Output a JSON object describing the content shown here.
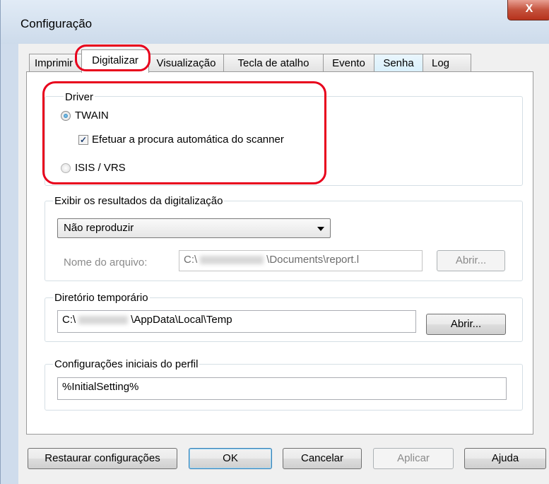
{
  "window": {
    "title": "Configuração",
    "close_label": "X"
  },
  "tabs": [
    {
      "label": "Imprimir"
    },
    {
      "label": "Digitalizar"
    },
    {
      "label": "Visualização"
    },
    {
      "label": "Tecla de atalho"
    },
    {
      "label": "Evento"
    },
    {
      "label": "Senha"
    },
    {
      "label": "Log"
    }
  ],
  "driver": {
    "group_label": "Driver",
    "twain_label": "TWAIN",
    "twain_selected": true,
    "auto_search_label": "Efetuar a procura automática do scanner",
    "auto_search_checked": true,
    "isis_label": "ISIS / VRS",
    "isis_selected": false
  },
  "results": {
    "group_label": "Exibir os resultados da digitalização",
    "selected_option": "Não reproduzir",
    "filename_label": "Nome do arquivo:",
    "filename_prefix": "C:\\",
    "filename_suffix": "\\Documents\\report.l",
    "browse_label": "Abrir..."
  },
  "temp_dir": {
    "group_label": "Diretório temporário",
    "path_prefix": "C:\\",
    "path_suffix": "\\AppData\\Local\\Temp",
    "browse_label": "Abrir..."
  },
  "profile": {
    "group_label": "Configurações iniciais do perfil",
    "value": "%InitialSetting%"
  },
  "footer": {
    "restore_label": "Restaurar configurações",
    "ok_label": "OK",
    "cancel_label": "Cancelar",
    "apply_label": "Aplicar",
    "help_label": "Ajuda"
  },
  "colors": {
    "highlight": "#e8001c",
    "accent": "#1d6fa8"
  }
}
